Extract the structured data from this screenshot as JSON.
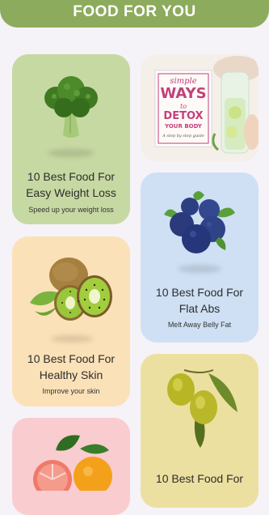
{
  "header": {
    "title": "FOOD FOR YOU"
  },
  "cards": [
    {
      "title_line1": "10 Best Food For",
      "title_line2": "Easy Weight Loss",
      "subtitle": "Speed up your weight loss",
      "icon": "broccoli-icon",
      "bg": "#c7d9a2"
    },
    {
      "banner_script": "simple",
      "banner_ways": "WAYS",
      "banner_to": "to",
      "banner_detox": "DETOX",
      "banner_body": "YOUR BODY",
      "banner_guide": "A step by step guide"
    },
    {
      "title_line1": "10 Best Food For",
      "title_line2": "Flat Abs",
      "subtitle": "Melt Away Belly Fat",
      "icon": "blueberries-icon",
      "bg": "#cfe0f4"
    },
    {
      "title_line1": "10 Best Food For",
      "title_line2": "Healthy Skin",
      "subtitle": "Improve your skin",
      "icon": "kiwi-icon",
      "bg": "#fbe1b7"
    },
    {
      "title_line1": "10 Best Food For",
      "icon": "olives-icon",
      "bg": "#ece0a0"
    },
    {
      "icon": "citrus-icon",
      "bg": "#f9ccd0"
    }
  ]
}
